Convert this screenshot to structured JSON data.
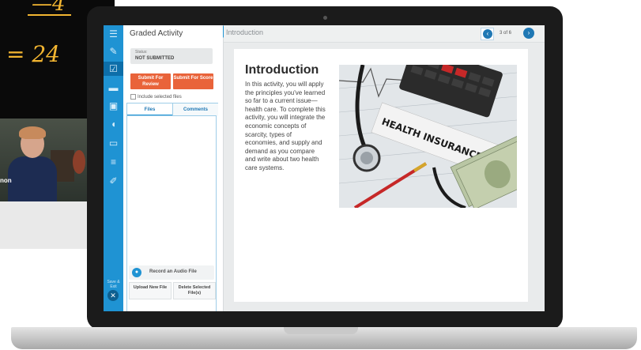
{
  "background": {
    "chalkboard": {
      "line1": "—4",
      "line2": "= 24"
    },
    "webcam": {
      "name_fragment": "non"
    }
  },
  "rail": {
    "icons": [
      "menu-icon",
      "edit-icon",
      "graded-activity-icon",
      "folder-icon",
      "book-icon",
      "audio-icon",
      "chat-icon",
      "notes-icon",
      "pen-icon"
    ],
    "save_exit_label": "Save & Exit"
  },
  "panel": {
    "title": "Graded Activity",
    "status_label": "Status:",
    "status_value": "NOT SUBMITTED",
    "submit_review": "Submit For Review",
    "submit_score": "Submit For Score",
    "include_label": "Include selected files",
    "tabs": [
      "Files",
      "Comments"
    ],
    "record_label": "Record an Audio File",
    "upload_label": "Upload New File",
    "delete_label": "Delete Selected File(s)"
  },
  "main": {
    "breadcrumb": "Introduction",
    "page_count": "3 of 6",
    "heading": "Introduction",
    "paragraph": "In this activity, you will apply the principles you've learned so far to a current issue—health care. To complete this activity, you will integrate the economic concepts of scarcity, types of economies, and supply and demand as you compare and write about two health care systems.",
    "photo_label": "HEALTH INSURANCE"
  },
  "colors": {
    "accent_blue": "#1f93d3",
    "submit_orange": "#e9633a",
    "nav_blue": "#1f78b4"
  }
}
